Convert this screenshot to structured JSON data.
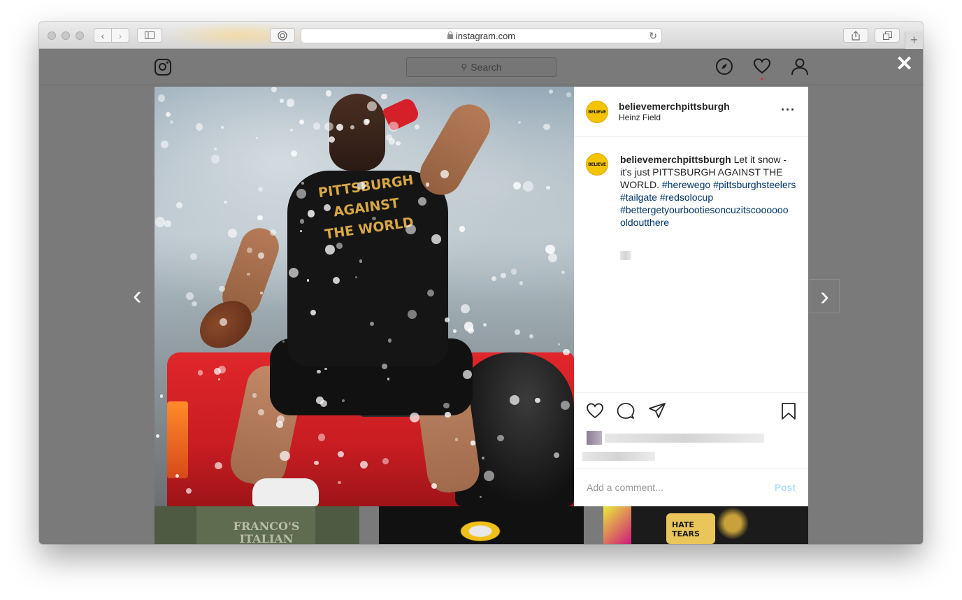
{
  "browser": {
    "url": "instagram.com"
  },
  "instagram": {
    "search_placeholder": "Search"
  },
  "post": {
    "username": "believemerchpittsburgh",
    "location": "Heinz Field",
    "avatar_text": "BELIEVE",
    "caption_text": " Let it snow - it's just PITTSBURGH AGAINST THE WORLD. ",
    "hashtags": [
      "#herewego",
      "#pittsburghsteelers",
      "#tailgate",
      "#redsolocup",
      "#bettergetyourbootiesoncuzitscoooooo oldoutthere"
    ],
    "shirt_lines": [
      "PITTSBURGH",
      "AGAINST",
      "THE WORLD"
    ],
    "comment_placeholder": "Add a comment...",
    "post_label": "Post"
  },
  "thumbnails": {
    "left_text": "FRANCO'S ITALIAN ARMY",
    "right_text": "HATE TEARS"
  },
  "colors": {
    "overlay": "#7a7a7a",
    "link": "#003569",
    "post_button": "#b2dffc",
    "avatar": "#f5c400",
    "notification_dot": "#ed4956"
  }
}
